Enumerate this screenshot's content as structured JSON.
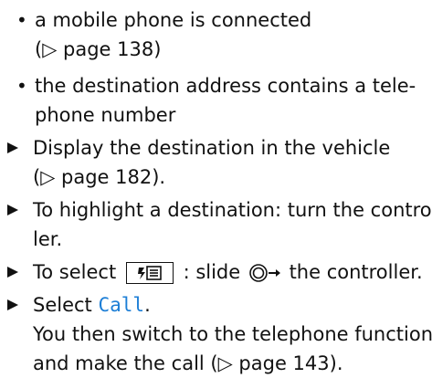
{
  "items": [
    {
      "marker": "•",
      "lines": [
        "a mobile phone is connected",
        "(▷ page 138)"
      ]
    },
    {
      "marker": "•",
      "lines": [
        "the destination address contains a tele-",
        "phone number"
      ]
    },
    {
      "marker": "▶",
      "lines": [
        "Display the destination in the vehicle",
        "(▷ page 182)."
      ]
    },
    {
      "marker": "▶",
      "lines": [
        "To highlight a destination: turn the control-",
        "ler."
      ]
    },
    {
      "marker": "▶",
      "line_prefix": "To select",
      "line_suffix_1": ": slide",
      "line_suffix_2": "the controller.",
      "key_icon": "phone-book-key-icon",
      "controller_icon": "slide-right-controller-icon"
    },
    {
      "marker": "▶",
      "lines": [
        "Select",
        "Call",
        "."
      ],
      "follow_lines": [
        "You then switch to the telephone function",
        "and make the call (▷ page 143)."
      ]
    }
  ]
}
